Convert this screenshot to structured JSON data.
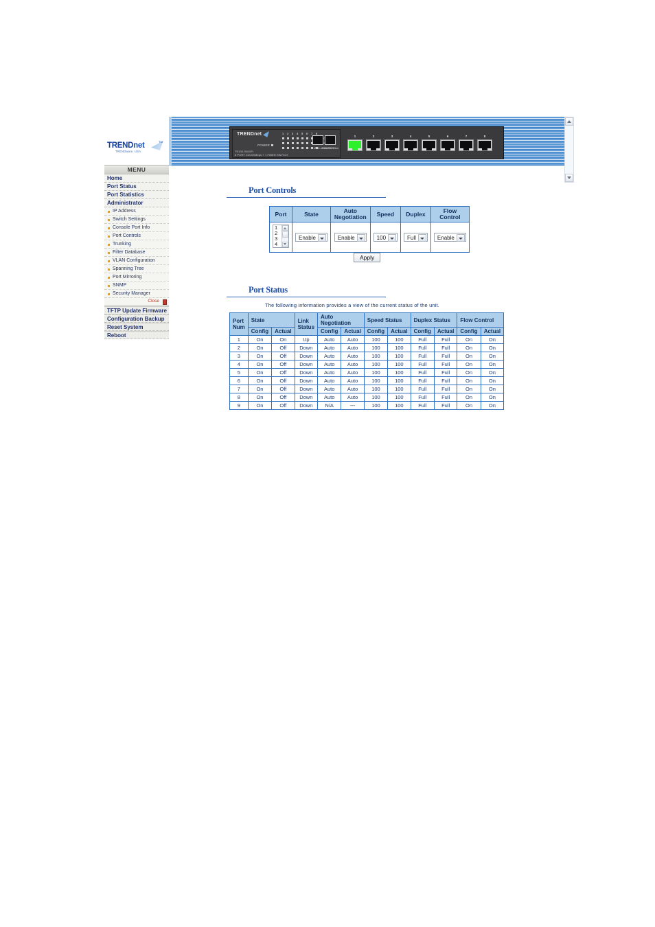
{
  "banner": {
    "device": {
      "brand": "TRENDnet",
      "power_label": "POWER",
      "model_line1": "TE100-S810Fi",
      "model_line2": "8 PORT 10/100Mbps + 1 FIBER SWITCH",
      "led_numbers": [
        "1",
        "2",
        "3",
        "4",
        "5",
        "6",
        "7",
        "8"
      ],
      "led_labels": [
        "100TX",
        "LINK/ACT",
        "FDX/COL"
      ],
      "bay_label": "Multi-mode/SC/Fiber",
      "port_numbers": [
        "1",
        "2",
        "3",
        "4",
        "5",
        "6",
        "7",
        "8"
      ],
      "active_port": 1,
      "active_port_color": "#2bf02b"
    }
  },
  "sidebar": {
    "logo": {
      "text_trend": "TREND",
      "text_net": "net",
      "trademark": "TM",
      "tagline": "TRENDware, USA"
    },
    "menu_header": "MENU",
    "top_items": [
      {
        "label": "Home"
      },
      {
        "label": "Port Status"
      },
      {
        "label": "Port Statistics"
      },
      {
        "label": "Administrator"
      }
    ],
    "sub_items": [
      {
        "label": "IP Address"
      },
      {
        "label": "Switch Settings"
      },
      {
        "label": "Console Port Info"
      },
      {
        "label": "Port Controls"
      },
      {
        "label": "Trunking"
      },
      {
        "label": "Filter Database"
      },
      {
        "label": "VLAN Configuration"
      },
      {
        "label": "Spanning Tree"
      },
      {
        "label": "Port Mirroring"
      },
      {
        "label": "SNMP"
      },
      {
        "label": "Security Manager"
      }
    ],
    "close_label": "Close",
    "bottom_items": [
      {
        "label": "TFTP Update Firmware"
      },
      {
        "label": "Configuration Backup"
      },
      {
        "label": "Reset System"
      },
      {
        "label": "Reboot"
      }
    ]
  },
  "port_controls": {
    "title": "Port Controls",
    "headers": [
      "Port",
      "State",
      "Auto Negotiation",
      "Speed",
      "Duplex",
      "Flow Control"
    ],
    "header_auto_line1": "Auto",
    "header_auto_line2": "Negotiation",
    "header_flow_line1": "Flow",
    "header_flow_line2": "Control",
    "port_list": [
      "1",
      "2",
      "3",
      "4"
    ],
    "state_value": "Enable",
    "autoneg_value": "Enable",
    "speed_value": "100",
    "duplex_value": "Full",
    "flow_value": "Enable",
    "apply_label": "Apply"
  },
  "port_status": {
    "title": "Port Status",
    "description": "The following information provides a view of the current status of the unit.",
    "group_headers": [
      "Port Num",
      "State",
      "Link Status",
      "Auto Negotiation",
      "Speed Status",
      "Duplex Status",
      "Flow Control"
    ],
    "group_port_line1": "Port",
    "group_port_line2": "Num",
    "group_link_line1": "Link",
    "group_link_line2": "Status",
    "group_auto_line1": "Auto",
    "group_auto_line2": "Negotiation",
    "sub_headers": [
      "Config",
      "Actual"
    ],
    "rows": [
      {
        "port": "1",
        "state_config": "On",
        "state_actual": "On",
        "link": "Up",
        "an_config": "Auto",
        "an_actual": "Auto",
        "sp_config": "100",
        "sp_actual": "100",
        "dx_config": "Full",
        "dx_actual": "Full",
        "fc_config": "On",
        "fc_actual": "On"
      },
      {
        "port": "2",
        "state_config": "On",
        "state_actual": "Off",
        "link": "Down",
        "an_config": "Auto",
        "an_actual": "Auto",
        "sp_config": "100",
        "sp_actual": "100",
        "dx_config": "Full",
        "dx_actual": "Full",
        "fc_config": "On",
        "fc_actual": "On"
      },
      {
        "port": "3",
        "state_config": "On",
        "state_actual": "Off",
        "link": "Down",
        "an_config": "Auto",
        "an_actual": "Auto",
        "sp_config": "100",
        "sp_actual": "100",
        "dx_config": "Full",
        "dx_actual": "Full",
        "fc_config": "On",
        "fc_actual": "On"
      },
      {
        "port": "4",
        "state_config": "On",
        "state_actual": "Off",
        "link": "Down",
        "an_config": "Auto",
        "an_actual": "Auto",
        "sp_config": "100",
        "sp_actual": "100",
        "dx_config": "Full",
        "dx_actual": "Full",
        "fc_config": "On",
        "fc_actual": "On"
      },
      {
        "port": "5",
        "state_config": "On",
        "state_actual": "Off",
        "link": "Down",
        "an_config": "Auto",
        "an_actual": "Auto",
        "sp_config": "100",
        "sp_actual": "100",
        "dx_config": "Full",
        "dx_actual": "Full",
        "fc_config": "On",
        "fc_actual": "On"
      },
      {
        "port": "6",
        "state_config": "On",
        "state_actual": "Off",
        "link": "Down",
        "an_config": "Auto",
        "an_actual": "Auto",
        "sp_config": "100",
        "sp_actual": "100",
        "dx_config": "Full",
        "dx_actual": "Full",
        "fc_config": "On",
        "fc_actual": "On"
      },
      {
        "port": "7",
        "state_config": "On",
        "state_actual": "Off",
        "link": "Down",
        "an_config": "Auto",
        "an_actual": "Auto",
        "sp_config": "100",
        "sp_actual": "100",
        "dx_config": "Full",
        "dx_actual": "Full",
        "fc_config": "On",
        "fc_actual": "On"
      },
      {
        "port": "8",
        "state_config": "On",
        "state_actual": "Off",
        "link": "Down",
        "an_config": "Auto",
        "an_actual": "Auto",
        "sp_config": "100",
        "sp_actual": "100",
        "dx_config": "Full",
        "dx_actual": "Full",
        "fc_config": "On",
        "fc_actual": "On"
      },
      {
        "port": "9",
        "state_config": "On",
        "state_actual": "Off",
        "link": "Down",
        "an_config": "N/A",
        "an_actual": "---",
        "sp_config": "100",
        "sp_actual": "100",
        "dx_config": "Full",
        "dx_actual": "Full",
        "fc_config": "On",
        "fc_actual": "On"
      }
    ]
  },
  "colors": {
    "accent_blue": "#1f4fa8",
    "table_header": "#aecfeb",
    "table_border": "#2f6fbf",
    "banner_blue": "#4a8fd0",
    "bullet_orange": "#f0a000",
    "close_red": "#c0392b"
  }
}
